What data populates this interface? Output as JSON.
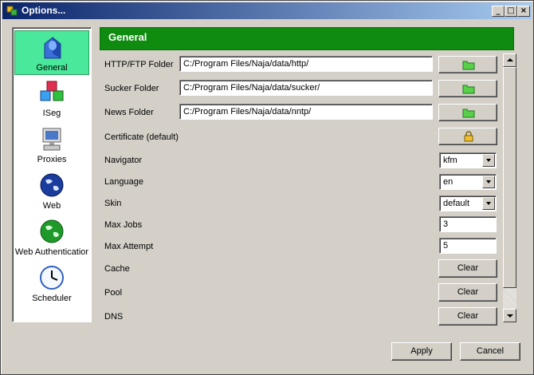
{
  "window": {
    "title": "Options..."
  },
  "caption_buttons": {
    "minimize": "_",
    "maximize": "□",
    "close": "×"
  },
  "sidebar": {
    "items": [
      {
        "label": "General",
        "icon": "general-icon",
        "active": true
      },
      {
        "label": "ISeg",
        "icon": "cubes-icon",
        "active": false
      },
      {
        "label": "Proxies",
        "icon": "computer-icon",
        "active": false
      },
      {
        "label": "Web",
        "icon": "globe-icon",
        "active": false
      },
      {
        "label": "Web Authenticatior",
        "icon": "green-globe-icon",
        "active": false
      },
      {
        "label": "Scheduler",
        "icon": "clock-icon",
        "active": false
      }
    ]
  },
  "panel": {
    "title": "General",
    "http_folder": {
      "label": "HTTP/FTP Folder",
      "value": "C:/Program Files/Naja/data/http/"
    },
    "sucker_folder": {
      "label": "Sucker Folder",
      "value": "C:/Program Files/Naja/data/sucker/"
    },
    "news_folder": {
      "label": "News Folder",
      "value": "C:/Program Files/Naja/data/nntp/"
    },
    "certificate": {
      "label": "Certificate (default)"
    },
    "navigator": {
      "label": "Navigator",
      "value": "kfm"
    },
    "language": {
      "label": "Language",
      "value": "en"
    },
    "skin": {
      "label": "Skin",
      "value": "default"
    },
    "max_jobs": {
      "label": "Max Jobs",
      "value": "3"
    },
    "max_attempt": {
      "label": "Max Attempt",
      "value": "5"
    },
    "cache": {
      "label": "Cache",
      "button": "Clear"
    },
    "pool": {
      "label": "Pool",
      "button": "Clear"
    },
    "dns": {
      "label": "DNS",
      "button": "Clear"
    }
  },
  "footer": {
    "apply": "Apply",
    "cancel": "Cancel"
  },
  "colors": {
    "header_green": "#0f8c0f",
    "active_item": "#4ae89a",
    "titlebar": "#0a246a"
  }
}
